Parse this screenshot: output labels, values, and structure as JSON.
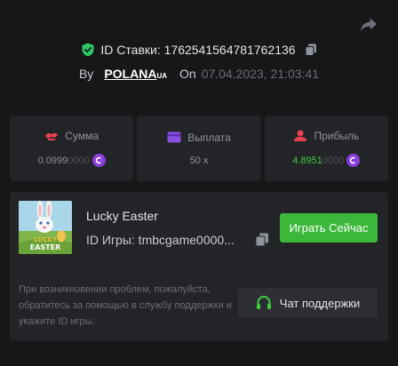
{
  "bet": {
    "id_label": "ID Ставки: 1762541564781762136",
    "by_label": "By",
    "username": "POLANA",
    "username_suffix": "UA",
    "on_label": "On",
    "date": "07.04.2023, 21:03:41"
  },
  "stats": [
    {
      "label": "Сумма",
      "value_main": "0.0999",
      "value_dim": "0000",
      "has_coin": true
    },
    {
      "label": "Выплата",
      "value_main": "50 x",
      "value_dim": "",
      "has_coin": false
    },
    {
      "label": "Прибыль",
      "value_main": "4.8951",
      "value_dim": "0000",
      "has_coin": true
    }
  ],
  "game": {
    "title": "Lucky Easter",
    "id_text": "ID Игры: tmbcgame0000...",
    "thumb_line1": "LUCKY",
    "thumb_line2": "EASTER",
    "play_label": "Играть Сейчас"
  },
  "support": {
    "help_text": "При возникновении проблем, пожалуйста, обратитесь за помощью в службу поддержки и укажите ID игры.",
    "button_label": "Чат поддержки"
  },
  "colors": {
    "background": "#161719",
    "card": "#232428",
    "accent_green": "#3bb83a",
    "profit_green": "#3fcf3c",
    "coin_purple": "#8a3ddb",
    "shield_green": "#2ec866",
    "sum_icon_red": "#e8424f",
    "payout_icon_purple": "#8a4fe0",
    "profit_icon_red": "#e8424f"
  },
  "icons": {
    "share": "share-icon",
    "shield": "shield-check-icon",
    "copy": "copy-icon",
    "sum": "bet-amount-icon",
    "payout": "wallet-icon",
    "profit": "profit-icon",
    "coin": "coin-icon",
    "headset": "headset-icon"
  }
}
